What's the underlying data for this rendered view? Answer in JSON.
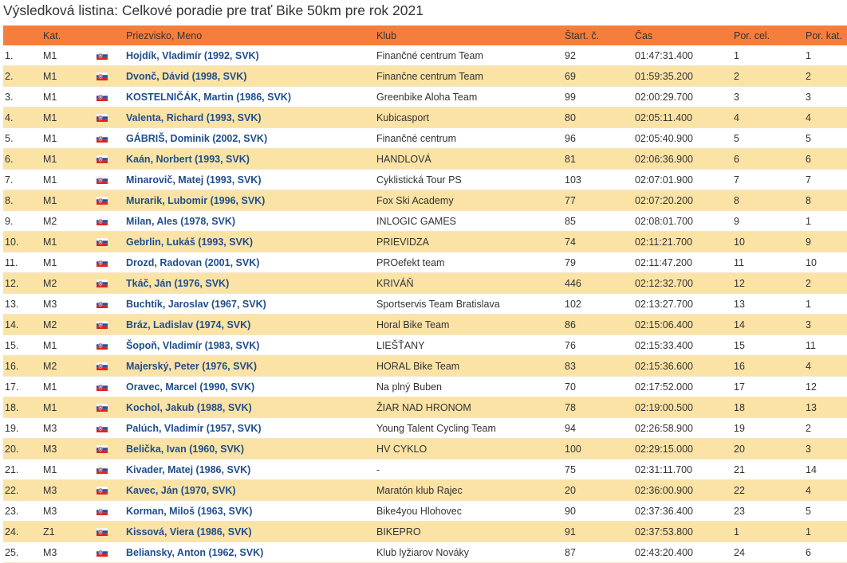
{
  "title": "Výsledková listina: Celkové poradie pre trať Bike 50km pre rok 2021",
  "columns": {
    "rank": "",
    "category": "Kat.",
    "flag": "",
    "name": "Priezvisko, Meno",
    "club": "Klub",
    "start": "Štart. č.",
    "time": "Čas",
    "overall": "Por. cel.",
    "catrank": "Por. kat."
  },
  "flag_icon": "slovakia-flag-icon",
  "colors": {
    "header": "#f57e3d",
    "row_alt": "#fbe3a6",
    "name_link": "#1f4e8c"
  },
  "rows": [
    {
      "rank": "1.",
      "cat": "M1",
      "name": "Hojdík, Vladimír (1992, SVK)",
      "club": "Finančné centrum Team",
      "start": "92",
      "time": "01:47:31.400",
      "overall": "1",
      "catrank": "1"
    },
    {
      "rank": "2.",
      "cat": "M1",
      "name": "Dvonč, Dávid (1998, SVK)",
      "club": "Finančne centrum Team",
      "start": "69",
      "time": "01:59:35.200",
      "overall": "2",
      "catrank": "2"
    },
    {
      "rank": "3.",
      "cat": "M1",
      "name": "KOSTELNIČÁK, Martin (1986, SVK)",
      "club": "Greenbike Aloha Team",
      "start": "99",
      "time": "02:00:29.700",
      "overall": "3",
      "catrank": "3"
    },
    {
      "rank": "4.",
      "cat": "M1",
      "name": "Valenta, Richard (1993, SVK)",
      "club": "Kubicasport",
      "start": "80",
      "time": "02:05:11.400",
      "overall": "4",
      "catrank": "4"
    },
    {
      "rank": "5.",
      "cat": "M1",
      "name": "GÁBRIŠ, Dominik (2002, SVK)",
      "club": "Finančné centrum",
      "start": "96",
      "time": "02:05:40.900",
      "overall": "5",
      "catrank": "5"
    },
    {
      "rank": "6.",
      "cat": "M1",
      "name": "Kaán, Norbert (1993, SVK)",
      "club": "HANDLOVÁ",
      "start": "81",
      "time": "02:06:36.900",
      "overall": "6",
      "catrank": "6"
    },
    {
      "rank": "7.",
      "cat": "M1",
      "name": "Minarovič, Matej (1993, SVK)",
      "club": "Cyklistická Tour PS",
      "start": "103",
      "time": "02:07:01.900",
      "overall": "7",
      "catrank": "7"
    },
    {
      "rank": "8.",
      "cat": "M1",
      "name": "Murarik, Lubomir (1996, SVK)",
      "club": "Fox Ski Academy",
      "start": "77",
      "time": "02:07:20.200",
      "overall": "8",
      "catrank": "8"
    },
    {
      "rank": "9.",
      "cat": "M2",
      "name": "Milan, Ales (1978, SVK)",
      "club": "INLOGIC GAMES",
      "start": "85",
      "time": "02:08:01.700",
      "overall": "9",
      "catrank": "1"
    },
    {
      "rank": "10.",
      "cat": "M1",
      "name": "Gebrlin, Lukáš (1993, SVK)",
      "club": "PRIEVIDZA",
      "start": "74",
      "time": "02:11:21.700",
      "overall": "10",
      "catrank": "9"
    },
    {
      "rank": "11.",
      "cat": "M1",
      "name": "Drozd, Radovan (2001, SVK)",
      "club": "PROefekt team",
      "start": "79",
      "time": "02:11:47.200",
      "overall": "11",
      "catrank": "10"
    },
    {
      "rank": "12.",
      "cat": "M2",
      "name": "Tkáč, Ján (1976, SVK)",
      "club": "KRIVÁŇ",
      "start": "446",
      "time": "02:12:32.700",
      "overall": "12",
      "catrank": "2"
    },
    {
      "rank": "13.",
      "cat": "M3",
      "name": "Buchtík, Jaroslav (1967, SVK)",
      "club": "Sportservis Team Bratislava",
      "start": "102",
      "time": "02:13:27.700",
      "overall": "13",
      "catrank": "1"
    },
    {
      "rank": "14.",
      "cat": "M2",
      "name": "Bráz, Ladislav (1974, SVK)",
      "club": "Horal Bike Team",
      "start": "86",
      "time": "02:15:06.400",
      "overall": "14",
      "catrank": "3"
    },
    {
      "rank": "15.",
      "cat": "M1",
      "name": "Šopoň, Vladimír (1983, SVK)",
      "club": "LIEŠŤANY",
      "start": "76",
      "time": "02:15:33.400",
      "overall": "15",
      "catrank": "11"
    },
    {
      "rank": "16.",
      "cat": "M2",
      "name": "Majerský, Peter (1976, SVK)",
      "club": "HORAL Bike Team",
      "start": "83",
      "time": "02:15:36.600",
      "overall": "16",
      "catrank": "4"
    },
    {
      "rank": "17.",
      "cat": "M1",
      "name": "Oravec, Marcel (1990, SVK)",
      "club": "Na plný Buben",
      "start": "70",
      "time": "02:17:52.000",
      "overall": "17",
      "catrank": "12"
    },
    {
      "rank": "18.",
      "cat": "M1",
      "name": "Kochol, Jakub (1988, SVK)",
      "club": "ŽIAR NAD HRONOM",
      "start": "78",
      "time": "02:19:00.500",
      "overall": "18",
      "catrank": "13"
    },
    {
      "rank": "19.",
      "cat": "M3",
      "name": "Palúch, Vladimír (1957, SVK)",
      "club": "Young Talent Cycling Team",
      "start": "94",
      "time": "02:26:58.900",
      "overall": "19",
      "catrank": "2"
    },
    {
      "rank": "20.",
      "cat": "M3",
      "name": "Belička, Ivan (1960, SVK)",
      "club": "HV CYKLO",
      "start": "100",
      "time": "02:29:15.000",
      "overall": "20",
      "catrank": "3"
    },
    {
      "rank": "21.",
      "cat": "M1",
      "name": "Kivader, Matej (1986, SVK)",
      "club": "-",
      "start": "75",
      "time": "02:31:11.700",
      "overall": "21",
      "catrank": "14"
    },
    {
      "rank": "22.",
      "cat": "M3",
      "name": "Kavec, Ján (1970, SVK)",
      "club": "Maratón klub Rajec",
      "start": "20",
      "time": "02:36:00.900",
      "overall": "22",
      "catrank": "4"
    },
    {
      "rank": "23.",
      "cat": "M3",
      "name": "Korman, Miloš (1963, SVK)",
      "club": "Bike4you Hlohovec",
      "start": "90",
      "time": "02:37:36.400",
      "overall": "23",
      "catrank": "5"
    },
    {
      "rank": "24.",
      "cat": "Z1",
      "name": "Kissová, Viera (1986, SVK)",
      "club": "BIKEPRO",
      "start": "91",
      "time": "02:37:53.800",
      "overall": "1",
      "catrank": "1"
    },
    {
      "rank": "25.",
      "cat": "M3",
      "name": "Beliansky, Anton (1962, SVK)",
      "club": "Klub lyžiarov Nováky",
      "start": "87",
      "time": "02:43:20.400",
      "overall": "24",
      "catrank": "6"
    }
  ]
}
